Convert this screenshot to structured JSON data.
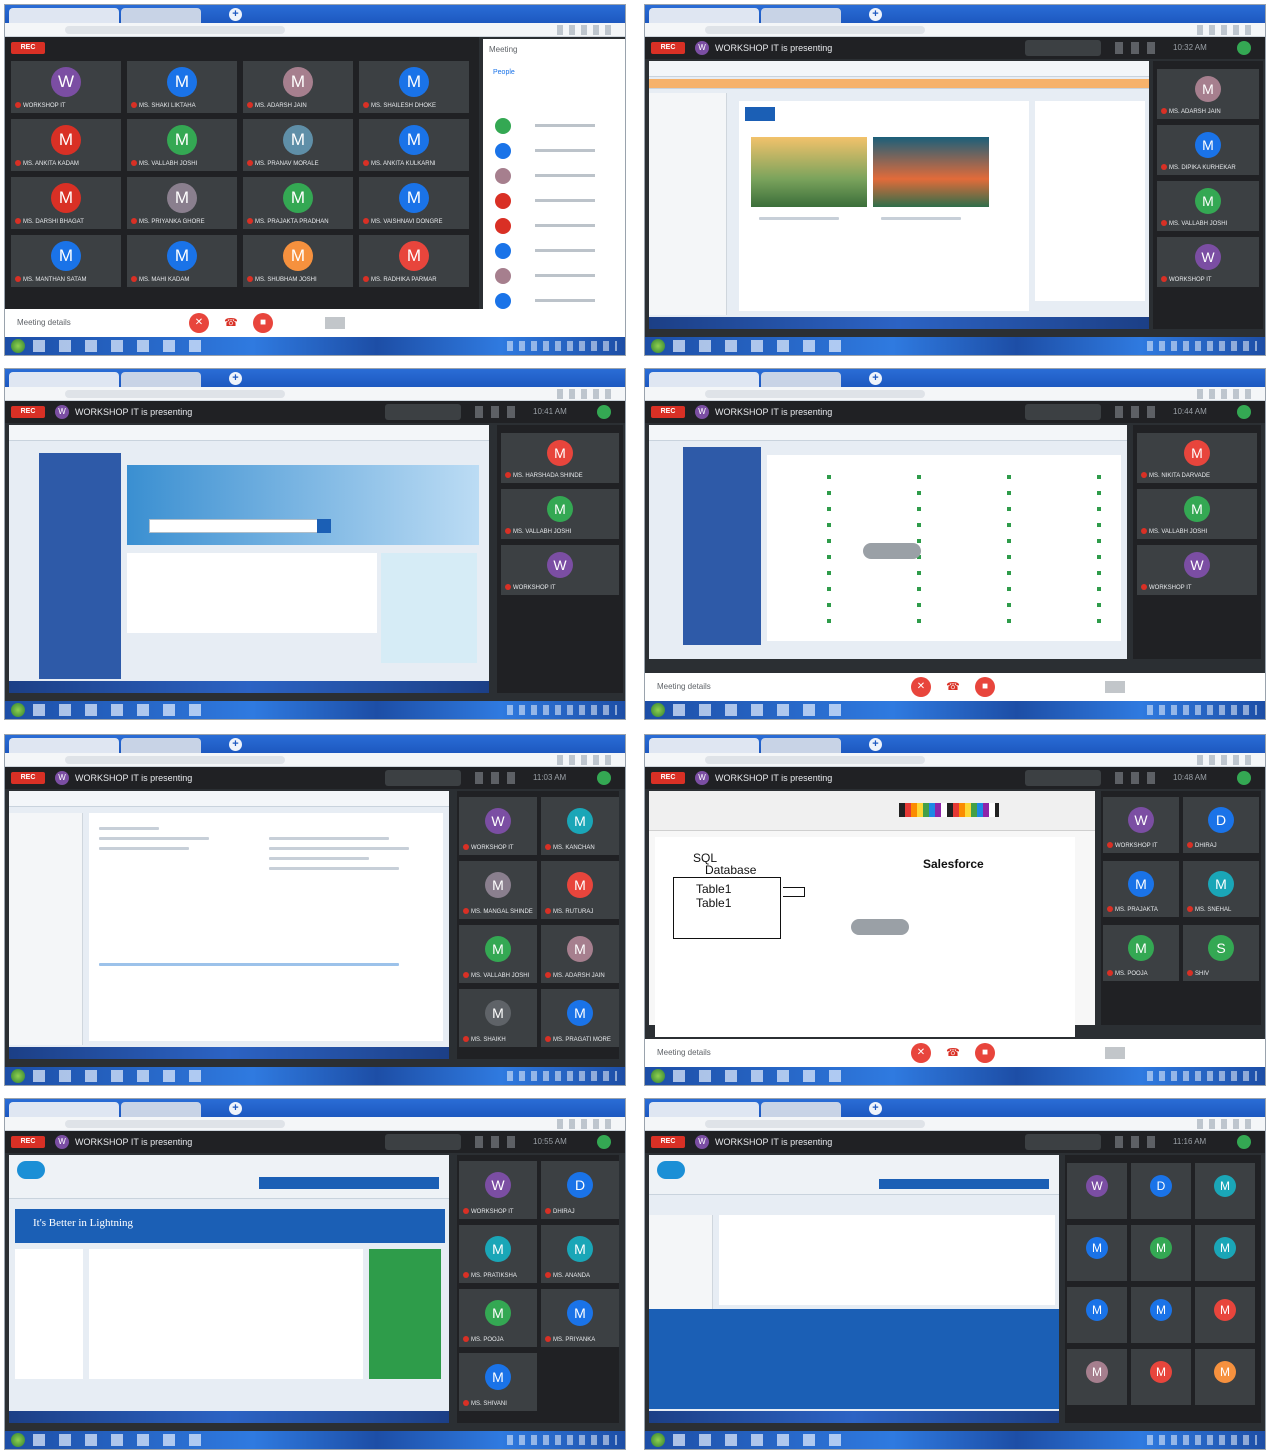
{
  "panels": [
    {
      "id": "panel-1",
      "rec": "REC",
      "tiles": [
        {
          "letter": "W",
          "color": "#7b4ea3",
          "name": "WORKSHOP IT"
        },
        {
          "letter": "M",
          "color": "#1a73e8",
          "name": "MS. SHAKI LIKTAHA"
        },
        {
          "letter": "M",
          "color": "#a67f8e",
          "name": "MS. ADARSH JAIN"
        },
        {
          "letter": "M",
          "color": "#1a73e8",
          "name": "MS. SHAILESH DHOKE"
        },
        {
          "letter": "M",
          "color": "#d93025",
          "name": "MS. ANKITA KADAM"
        },
        {
          "letter": "M",
          "color": "#34a853",
          "name": "MS. VALLABH JOSHI"
        },
        {
          "letter": "M",
          "color": "#5f8fa8",
          "name": "MS. PRANAV MORALE"
        },
        {
          "letter": "M",
          "color": "#1a73e8",
          "name": "MS. ANKITA KULKARNI"
        },
        {
          "letter": "M",
          "color": "#d93025",
          "name": "MS. DARSHI BHAGAT"
        },
        {
          "letter": "M",
          "color": "#8a7f8e",
          "name": "MS. PRIYANKA GHORE"
        },
        {
          "letter": "M",
          "color": "#34a853",
          "name": "MS. PRAJAKTA PRADHAN"
        },
        {
          "letter": "M",
          "color": "#1a73e8",
          "name": "MS. VAISHNAVI DONGRE"
        },
        {
          "letter": "M",
          "color": "#1a73e8",
          "name": "MS. MANTHAN SATAM"
        },
        {
          "letter": "M",
          "color": "#1a73e8",
          "name": "MS. MAHI KADAM"
        },
        {
          "letter": "M",
          "color": "#f6913e",
          "name": "MS. SHUBHAM JOSHI"
        },
        {
          "letter": "M",
          "color": "#e8453c",
          "name": "MS. RADHIKA PARMAR"
        }
      ],
      "details": "Meeting details",
      "people_title": "Meeting",
      "people_tab": "People",
      "people_colors": [
        "#34a853",
        "#1a73e8",
        "#a67f8e",
        "#d93025",
        "#d93025",
        "#1a73e8",
        "#a67f8e",
        "#1a73e8",
        "#d93025"
      ]
    },
    {
      "id": "panel-2",
      "presenting": "WORKSHOP IT is presenting",
      "clock": "10:32 AM",
      "tiles": [
        {
          "letter": "M",
          "color": "#a67f8e",
          "name": "MS. ADARSH JAIN"
        },
        {
          "letter": "M",
          "color": "#1a73e8",
          "name": "MS. DIPIKA KURHEKAR"
        },
        {
          "letter": "M",
          "color": "#34a853",
          "name": "MS. VALLABH JOSHI"
        },
        {
          "letter": "W",
          "color": "#7b4ea3",
          "name": "WORKSHOP IT"
        }
      ]
    },
    {
      "id": "panel-3",
      "presenting": "WORKSHOP IT is presenting",
      "clock": "10:41 AM",
      "tiles": [
        {
          "letter": "M",
          "color": "#e8453c",
          "name": "MS. HARSHADA SHINDE"
        },
        {
          "letter": "M",
          "color": "#34a853",
          "name": "MS. VALLABH JOSHI"
        },
        {
          "letter": "W",
          "color": "#7b4ea3",
          "name": "WORKSHOP IT"
        }
      ]
    },
    {
      "id": "panel-4",
      "presenting": "WORKSHOP IT is presenting",
      "clock": "10:44 AM",
      "tiles": [
        {
          "letter": "M",
          "color": "#e8453c",
          "name": "MS. NIKITA DARVADE"
        },
        {
          "letter": "M",
          "color": "#34a853",
          "name": "MS. VALLABH JOSHI"
        },
        {
          "letter": "W",
          "color": "#7b4ea3",
          "name": "WORKSHOP IT"
        }
      ]
    },
    {
      "id": "panel-5",
      "presenting": "WORKSHOP IT is presenting",
      "clock": "11:03 AM",
      "tiles": [
        {
          "letter": "W",
          "color": "#7b4ea3",
          "name": "WORKSHOP IT"
        },
        {
          "letter": "M",
          "color": "#1aa6b7",
          "name": "MS. KANCHAN"
        },
        {
          "letter": "M",
          "color": "#8a7f8e",
          "name": "MS. MANGAL SHINDE"
        },
        {
          "letter": "M",
          "color": "#e8453c",
          "name": "MS. RUTURAJ"
        },
        {
          "letter": "M",
          "color": "#34a853",
          "name": "MS. VALLABH JOSHI"
        },
        {
          "letter": "M",
          "color": "#a67f8e",
          "name": "MS. ADARSH JAIN"
        },
        {
          "letter": "M",
          "color": "#5f6368",
          "name": "MS. SHAIKH"
        },
        {
          "letter": "M",
          "color": "#1a73e8",
          "name": "MS. PRAGATI MORE"
        }
      ]
    },
    {
      "id": "panel-6",
      "presenting": "WORKSHOP IT is presenting",
      "clock": "10:48 AM",
      "sql": "SQL",
      "database": "Database",
      "salesforce": "Salesforce",
      "table1": "Table1",
      "table2": "Table1",
      "tiles": [
        {
          "letter": "W",
          "color": "#7b4ea3",
          "name": "WORKSHOP IT"
        },
        {
          "letter": "D",
          "color": "#1a73e8",
          "name": "DHIRAJ"
        },
        {
          "letter": "M",
          "color": "#1a73e8",
          "name": "MS. PRAJAKTA"
        },
        {
          "letter": "M",
          "color": "#1aa6b7",
          "name": "MS. SNEHAL"
        },
        {
          "letter": "M",
          "color": "#34a853",
          "name": "MS. POOJA"
        },
        {
          "letter": "S",
          "color": "#34a853",
          "name": "SHIV"
        }
      ]
    },
    {
      "id": "panel-7",
      "presenting": "WORKSHOP IT is presenting",
      "clock": "10:55 AM",
      "banner": "It's Better in Lightning",
      "tiles": [
        {
          "letter": "W",
          "color": "#7b4ea3",
          "name": "WORKSHOP IT"
        },
        {
          "letter": "D",
          "color": "#1a73e8",
          "name": "DHIRAJ"
        },
        {
          "letter": "M",
          "color": "#1aa6b7",
          "name": "MS. PRATIKSHA"
        },
        {
          "letter": "M",
          "color": "#1aa6b7",
          "name": "MS. ANANDA"
        },
        {
          "letter": "M",
          "color": "#34a853",
          "name": "MS. POOJA"
        },
        {
          "letter": "M",
          "color": "#1a73e8",
          "name": "MS. PRIYANKA"
        },
        {
          "letter": "M",
          "color": "#1a73e8",
          "name": "MS. SHIVANI"
        }
      ]
    },
    {
      "id": "panel-8",
      "presenting": "WORKSHOP IT is presenting",
      "clock": "11:16 AM",
      "tiles": [
        {
          "letter": "W",
          "color": "#7b4ea3",
          "name": ""
        },
        {
          "letter": "D",
          "color": "#1a73e8",
          "name": ""
        },
        {
          "letter": "M",
          "color": "#1aa6b7",
          "name": ""
        },
        {
          "letter": "M",
          "color": "#1a73e8",
          "name": ""
        },
        {
          "letter": "M",
          "color": "#34a853",
          "name": ""
        },
        {
          "letter": "M",
          "color": "#1aa6b7",
          "name": ""
        },
        {
          "letter": "M",
          "color": "#1a73e8",
          "name": ""
        },
        {
          "letter": "M",
          "color": "#1a73e8",
          "name": ""
        },
        {
          "letter": "M",
          "color": "#e8453c",
          "name": ""
        },
        {
          "letter": "M",
          "color": "#a67f8e",
          "name": ""
        },
        {
          "letter": "M",
          "color": "#e8453c",
          "name": ""
        },
        {
          "letter": "M",
          "color": "#f6913e",
          "name": ""
        }
      ]
    }
  ]
}
